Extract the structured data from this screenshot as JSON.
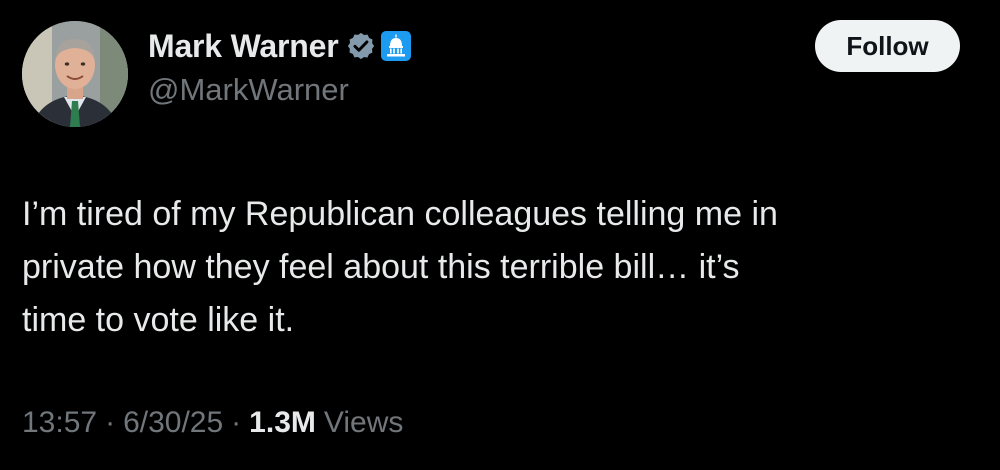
{
  "author": {
    "display_name": "Mark Warner",
    "handle": "@MarkWarner",
    "avatar": "avatar-photo",
    "verified_icon": "verified-badge-icon",
    "affiliation_icon": "capitol-dome-icon"
  },
  "follow_button": {
    "label": "Follow"
  },
  "tweet": {
    "text": "I’m tired of my Republican colleagues telling me in\nprivate how they feel about this terrible bill… it’s\ntime to vote like it."
  },
  "meta": {
    "time": "13:57",
    "separator": "·",
    "date": "6/30/25",
    "views_count": "1.3M",
    "views_label": "Views"
  },
  "colors": {
    "background": "#000000",
    "primary_text": "#e7e9ea",
    "secondary_text": "#71767b",
    "verified": "#829aab",
    "affiliation": "#1d9bf0",
    "button_bg": "#eff3f4"
  }
}
